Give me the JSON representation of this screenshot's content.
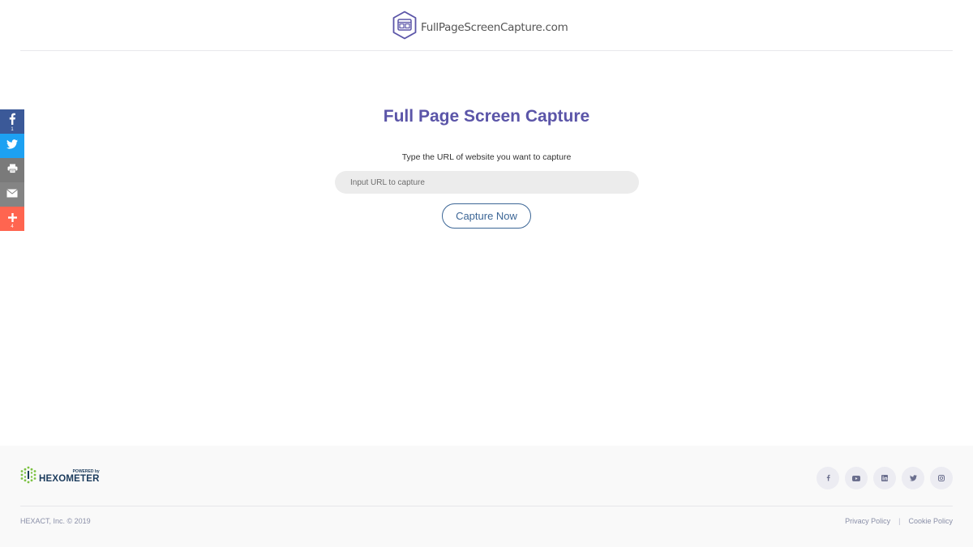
{
  "header": {
    "logo_text": "FullPageScreenCapture.com",
    "logo_icon": "browser-window-hexagon-icon"
  },
  "share_bar": {
    "items": [
      {
        "name": "facebook",
        "icon": "facebook-icon",
        "color": "#3b5998",
        "count": "1"
      },
      {
        "name": "twitter",
        "icon": "twitter-icon",
        "color": "#1da1f2",
        "count": ""
      },
      {
        "name": "print",
        "icon": "print-icon",
        "color": "#7a7a7a",
        "count": ""
      },
      {
        "name": "email",
        "icon": "email-icon",
        "color": "#848484",
        "count": ""
      },
      {
        "name": "more",
        "icon": "plus-icon",
        "color": "#ff6550",
        "count": "4"
      }
    ]
  },
  "main": {
    "title": "Full Page Screen Capture",
    "subtitle": "Type the URL of website you want to capture",
    "url_input": {
      "value": "",
      "placeholder": "Input URL to capture"
    },
    "capture_button": "Capture Now"
  },
  "footer": {
    "powered_by": "POWERED by",
    "brand": "HEXOMETER",
    "socials": [
      {
        "name": "facebook",
        "icon": "facebook-icon"
      },
      {
        "name": "youtube",
        "icon": "youtube-icon"
      },
      {
        "name": "linkedin",
        "icon": "linkedin-icon"
      },
      {
        "name": "twitter",
        "icon": "twitter-icon"
      },
      {
        "name": "instagram",
        "icon": "instagram-icon"
      }
    ],
    "copyright": "HEXACT, Inc. © 2019",
    "links": {
      "privacy": "Privacy Policy",
      "separator": "|",
      "cookie": "Cookie Policy"
    }
  },
  "colors": {
    "accent_title": "#5b55a8",
    "button_border": "#3c6696",
    "footer_bg": "#f9f9f9"
  }
}
